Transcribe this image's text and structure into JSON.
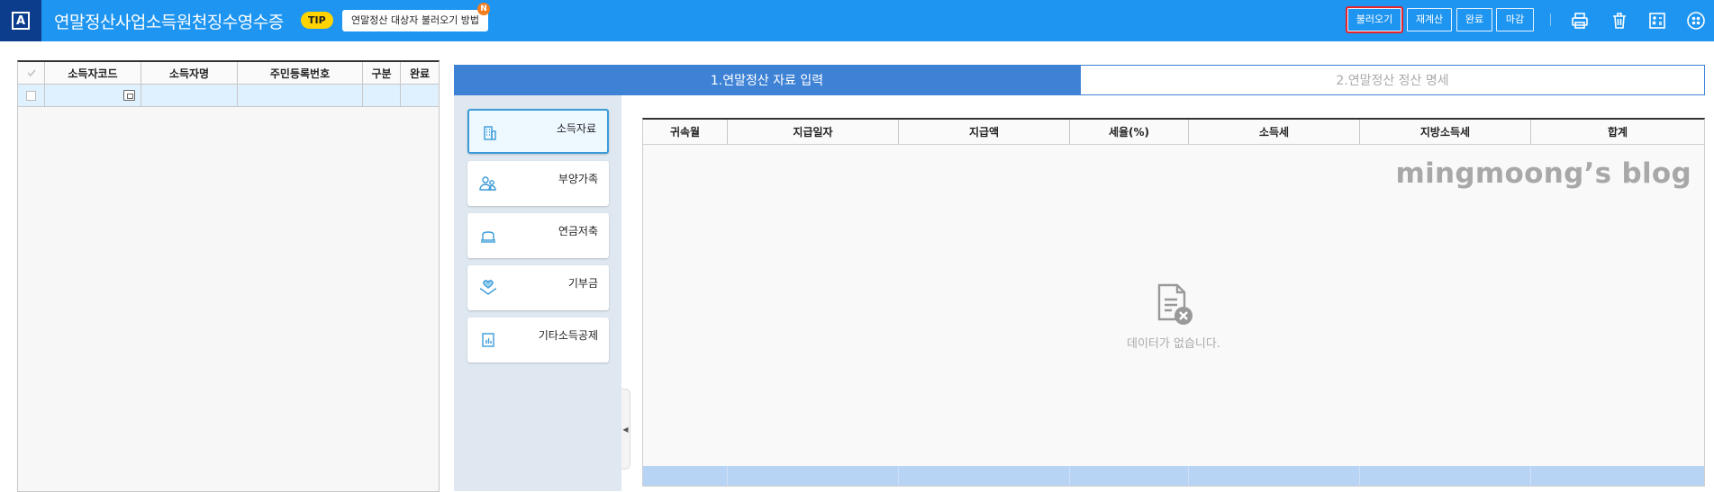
{
  "header": {
    "logo_letter": "A",
    "title": "연말정산사업소득원천징수영수증",
    "tip_label": "TIP",
    "tip_link": "연말정산 대상자 불러오기 방법",
    "new_badge": "N",
    "buttons": {
      "load": "불러오기",
      "recalc": "재계산",
      "done": "완료",
      "close": "마감"
    },
    "icons": [
      "print-icon",
      "trash-icon",
      "calculator-icon",
      "menu-icon"
    ]
  },
  "left_grid": {
    "columns": [
      "소득자코드",
      "소득자명",
      "주민등록번호",
      "구분",
      "완료"
    ],
    "rows": [
      {
        "code": "",
        "name": "",
        "rrn": "",
        "type": "",
        "done": ""
      }
    ]
  },
  "tabs": {
    "input": "1.연말정산 자료 입력",
    "result": "2.연말정산 정산 명세"
  },
  "side_menu": [
    {
      "label": "소득자료",
      "icon": "building-icon",
      "active": true
    },
    {
      "label": "부양가족",
      "icon": "family-icon",
      "active": false
    },
    {
      "label": "연금저축",
      "icon": "pension-icon",
      "active": false
    },
    {
      "label": "기부금",
      "icon": "donation-icon",
      "active": false
    },
    {
      "label": "기타소득공제",
      "icon": "chart-doc-icon",
      "active": false
    }
  ],
  "main_grid": {
    "columns": [
      "귀속월",
      "지급일자",
      "지급액",
      "세율(%)",
      "소득세",
      "지방소득세",
      "합계"
    ],
    "empty_text": "데이터가 없습니다.",
    "watermark": "mingmoong’s blog"
  },
  "colors": {
    "header": "#1e95f0",
    "logo": "#0c3d8c",
    "tab_active": "#3e82d6",
    "highlight": "#e8232a",
    "side_panel": "#dfe8f1",
    "footer_row": "#b8d4f4"
  }
}
